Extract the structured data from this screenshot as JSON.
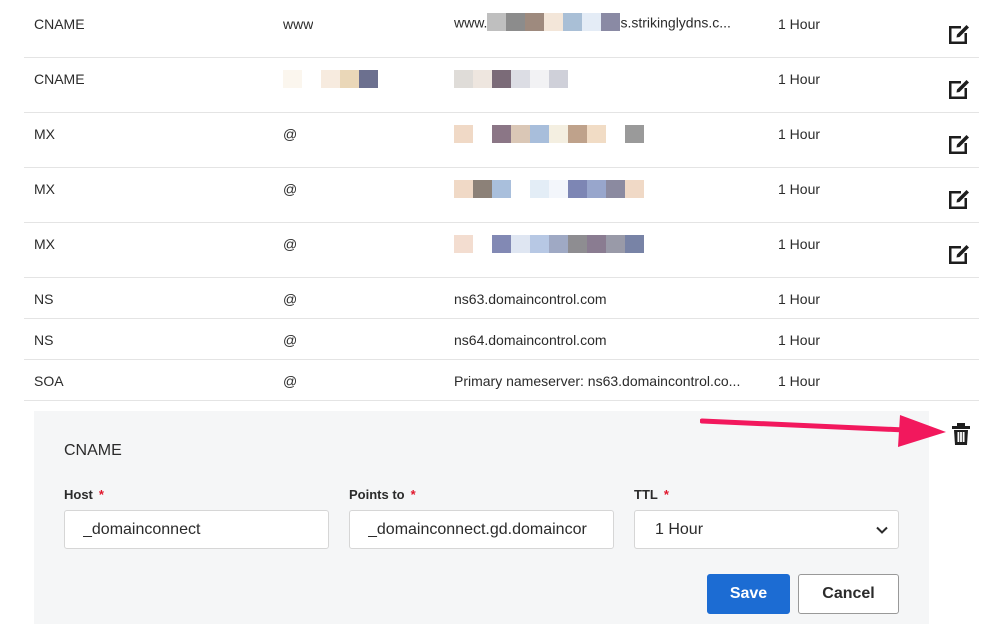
{
  "records": [
    {
      "type": "CNAME",
      "name": "www",
      "value_prefix": "www.",
      "value_suffix": "s.strikinglydns.c...",
      "ttl": "1 Hour",
      "editable": true,
      "redacted_colors": [
        "#bfbfbf",
        "#8c8c8c",
        "#9e8a7e",
        "#f3e6d9",
        "#a9bfd6",
        "#e4ecf6",
        "#8a8aa4"
      ]
    },
    {
      "type": "CNAME",
      "name": "",
      "value_prefix": "",
      "value_suffix": "",
      "ttl": "1 Hour",
      "editable": true,
      "name_redacted_colors": [
        "#fbf6ee",
        "#fff",
        "#f7ebdf",
        "#ead7b8",
        "#6c708f"
      ],
      "redacted_colors": [
        "#dfdcd8",
        "#eee6df",
        "#7b6b78",
        "#dcdde4",
        "#f2f2f4",
        "#cfd0d9"
      ]
    },
    {
      "type": "MX",
      "name": "@",
      "value_prefix": "",
      "value_suffix": "",
      "ttl": "1 Hour",
      "editable": true,
      "redacted_colors": [
        "#f0d9c6",
        "#fff",
        "#8b7686",
        "#dac7b6",
        "#a8bedb",
        "#f4efe1",
        "#bfa28b",
        "#f1dcc5",
        "#fff",
        "#9a9a9a"
      ]
    },
    {
      "type": "MX",
      "name": "@",
      "value_prefix": "",
      "value_suffix": "",
      "ttl": "1 Hour",
      "editable": true,
      "redacted_colors": [
        "#f0d9c6",
        "#8c8178",
        "#a9bfdc",
        "#fff",
        "#e3edf6",
        "#f3f6fb",
        "#7d86b4",
        "#98a6cc",
        "#8b8aa0",
        "#f0d9c6"
      ]
    },
    {
      "type": "MX",
      "name": "@",
      "value_prefix": "",
      "value_suffix": "",
      "ttl": "1 Hour",
      "editable": true,
      "redacted_colors": [
        "#f3ddd0",
        "#fff",
        "#8289b4",
        "#dfe6f2",
        "#b7c8e4",
        "#9fa9c4",
        "#8e8d91",
        "#8a7c91",
        "#999aa8",
        "#7883a6"
      ]
    },
    {
      "type": "NS",
      "name": "@",
      "value": "ns63.domaincontrol.com",
      "ttl": "1 Hour",
      "editable": false
    },
    {
      "type": "NS",
      "name": "@",
      "value": "ns64.domaincontrol.com",
      "ttl": "1 Hour",
      "editable": false
    },
    {
      "type": "SOA",
      "name": "@",
      "value": "Primary nameserver: ns63.domaincontrol.co...",
      "ttl": "1 Hour",
      "editable": false
    }
  ],
  "edit_panel": {
    "title": "CNAME",
    "host_label": "Host",
    "points_label": "Points to",
    "ttl_label": "TTL",
    "required_mark": "*",
    "host_value": "_domainconnect",
    "points_value": "_domainconnect.gd.domaincor",
    "ttl_value": "1 Hour",
    "save_label": "Save",
    "cancel_label": "Cancel"
  },
  "icons": {
    "edit": "edit-icon",
    "delete": "trash-icon",
    "annotation": "arrow-icon",
    "dropdown": "chevron-down-icon"
  },
  "colors": {
    "accent": "#1c6cd3",
    "annotation": "#f2185d",
    "required": "#e0162b",
    "panel_bg": "#f5f6f7"
  }
}
